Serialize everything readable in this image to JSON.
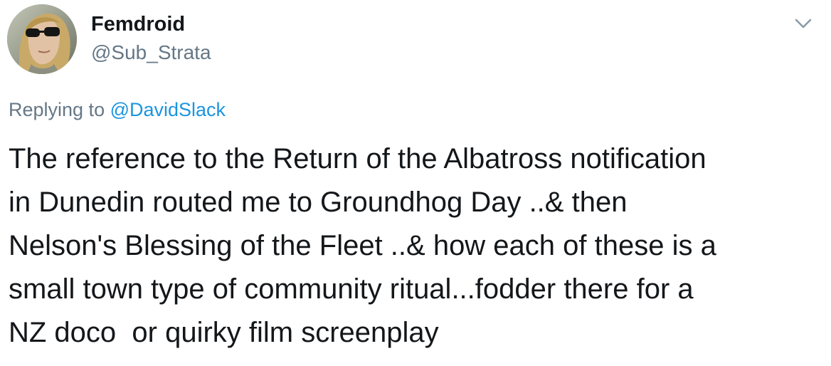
{
  "author": {
    "display_name": "Femdroid",
    "handle": "@Sub_Strata",
    "avatar_icon": "profile-photo-avatar"
  },
  "menu": {
    "caret_icon": "chevron-down-icon"
  },
  "reply": {
    "prefix": "Replying to ",
    "mention": "@DavidSlack"
  },
  "tweet": {
    "text": "The reference to the Return of the Albatross notification\nin Dunedin routed me to Groundhog Day ..& then\nNelson's Blessing of the Fleet ..& how each of these is a\nsmall town type of community ritual...fodder there for a\nNZ doco  or quirky film screenplay"
  },
  "colors": {
    "text_primary": "#14171a",
    "text_secondary": "#657786",
    "link": "#1b95e0",
    "background": "#ffffff"
  }
}
